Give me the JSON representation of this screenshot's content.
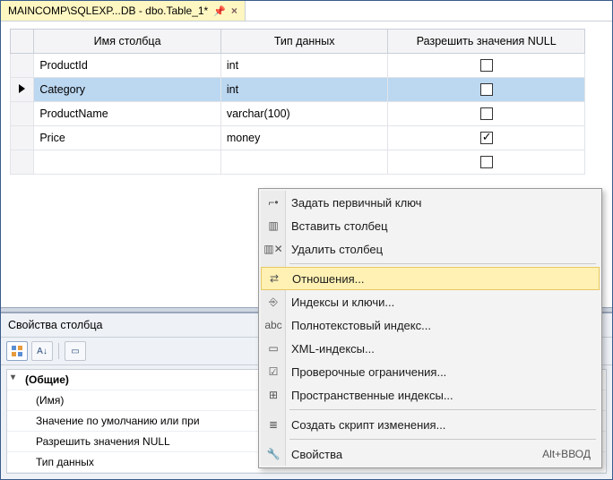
{
  "tab": {
    "title": "MAINCOMP\\SQLEXP...DB - dbo.Table_1*"
  },
  "grid": {
    "headers": {
      "name": "Имя столбца",
      "type": "Тип данных",
      "nulls": "Разрешить значения NULL"
    },
    "rows": [
      {
        "name": "ProductId",
        "type": "int",
        "null": false,
        "selected": false
      },
      {
        "name": "Category",
        "type": "int",
        "null": false,
        "selected": true
      },
      {
        "name": "ProductName",
        "type": "varchar(100)",
        "null": false,
        "selected": false
      },
      {
        "name": "Price",
        "type": "money",
        "null": true,
        "selected": false
      }
    ]
  },
  "props": {
    "title": "Свойства столбца",
    "category": "(Общие)",
    "items": [
      "(Имя)",
      "Значение по умолчанию или при",
      "Разрешить значения NULL",
      "Тип данных"
    ]
  },
  "menu": {
    "items": [
      {
        "id": "set-pk",
        "label": "Задать первичный ключ",
        "icon": "key-icon"
      },
      {
        "id": "insert-col",
        "label": "Вставить столбец",
        "icon": "insert-col-icon"
      },
      {
        "id": "delete-col",
        "label": "Удалить столбец",
        "icon": "delete-col-icon"
      },
      {
        "sep": true
      },
      {
        "id": "relations",
        "label": "Отношения...",
        "icon": "relation-icon",
        "highlight": true
      },
      {
        "id": "indexes",
        "label": "Индексы и ключи...",
        "icon": "index-icon"
      },
      {
        "id": "fulltext",
        "label": "Полнотекстовый индекс...",
        "icon": "fulltext-icon"
      },
      {
        "id": "xml-idx",
        "label": "XML-индексы...",
        "icon": "xml-icon"
      },
      {
        "id": "check",
        "label": "Проверочные ограничения...",
        "icon": "check-icon"
      },
      {
        "id": "spatial",
        "label": "Пространственные индексы...",
        "icon": "spatial-icon"
      },
      {
        "sep": true
      },
      {
        "id": "script",
        "label": "Создать скрипт изменения...",
        "icon": "script-icon"
      },
      {
        "sep": true
      },
      {
        "id": "properties",
        "label": "Свойства",
        "icon": "wrench-icon",
        "shortcut": "Alt+ВВОД"
      }
    ]
  }
}
